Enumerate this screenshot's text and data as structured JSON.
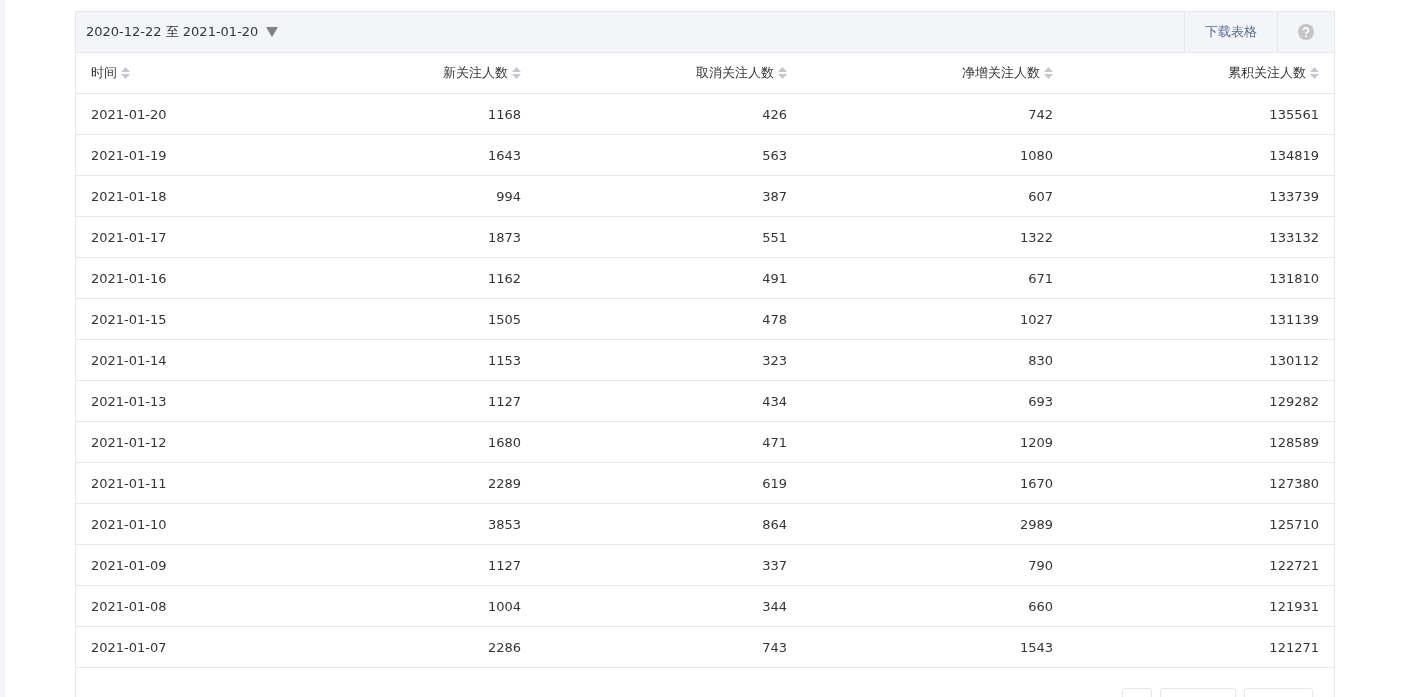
{
  "toolbar": {
    "date_range": "2020-12-22 至 2021-01-20",
    "download_label": "下载表格"
  },
  "table": {
    "columns": [
      "时间",
      "新关注人数",
      "取消关注人数",
      "净增关注人数",
      "累积关注人数"
    ],
    "rows": [
      [
        "2021-01-20",
        "1168",
        "426",
        "742",
        "135561"
      ],
      [
        "2021-01-19",
        "1643",
        "563",
        "1080",
        "134819"
      ],
      [
        "2021-01-18",
        "994",
        "387",
        "607",
        "133739"
      ],
      [
        "2021-01-17",
        "1873",
        "551",
        "1322",
        "133132"
      ],
      [
        "2021-01-16",
        "1162",
        "491",
        "671",
        "131810"
      ],
      [
        "2021-01-15",
        "1505",
        "478",
        "1027",
        "131139"
      ],
      [
        "2021-01-14",
        "1153",
        "323",
        "830",
        "130112"
      ],
      [
        "2021-01-13",
        "1127",
        "434",
        "693",
        "129282"
      ],
      [
        "2021-01-12",
        "1680",
        "471",
        "1209",
        "128589"
      ],
      [
        "2021-01-11",
        "2289",
        "619",
        "1670",
        "127380"
      ],
      [
        "2021-01-10",
        "3853",
        "864",
        "2989",
        "125710"
      ],
      [
        "2021-01-09",
        "1127",
        "337",
        "790",
        "122721"
      ],
      [
        "2021-01-08",
        "1004",
        "344",
        "660",
        "121931"
      ],
      [
        "2021-01-07",
        "2286",
        "743",
        "1543",
        "121271"
      ]
    ]
  }
}
